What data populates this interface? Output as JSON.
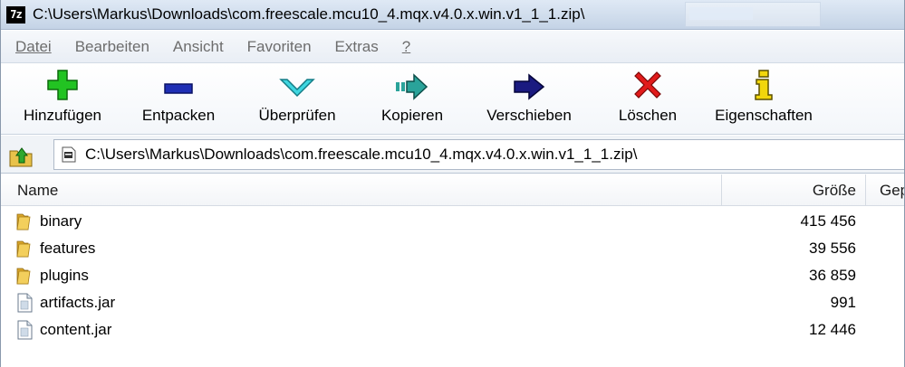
{
  "window": {
    "title": "C:\\Users\\Markus\\Downloads\\com.freescale.mcu10_4.mqx.v4.0.x.win.v1_1_1.zip\\",
    "app_icon_label": "7z"
  },
  "menu": {
    "items": [
      {
        "label": "Datei"
      },
      {
        "label": "Bearbeiten"
      },
      {
        "label": "Ansicht"
      },
      {
        "label": "Favoriten"
      },
      {
        "label": "Extras"
      },
      {
        "label": "?"
      }
    ]
  },
  "toolbar": {
    "buttons": [
      {
        "label": "Hinzufügen",
        "icon": "plus-icon",
        "color": "#22c322"
      },
      {
        "label": "Entpacken",
        "icon": "minus-icon",
        "color": "#1f2fb5"
      },
      {
        "label": "Überprüfen",
        "icon": "check-icon",
        "color": "#3fd6e0"
      },
      {
        "label": "Kopieren",
        "icon": "copy-arrow-icon",
        "color": "#2aa39a"
      },
      {
        "label": "Verschieben",
        "icon": "move-arrow-icon",
        "color": "#1a1a80"
      },
      {
        "label": "Löschen",
        "icon": "delete-x-icon",
        "color": "#e11b1b"
      },
      {
        "label": "Eigenschaften",
        "icon": "info-icon",
        "color": "#f2d60c"
      }
    ]
  },
  "address": {
    "path": "C:\\Users\\Markus\\Downloads\\com.freescale.mcu10_4.mqx.v4.0.x.win.v1_1_1.zip\\"
  },
  "list": {
    "columns": [
      {
        "label": "Name"
      },
      {
        "label": "Größe"
      },
      {
        "label": "Gep"
      }
    ],
    "rows": [
      {
        "name": "binary",
        "size": "415 456",
        "type": "folder"
      },
      {
        "name": "features",
        "size": "39 556",
        "type": "folder"
      },
      {
        "name": "plugins",
        "size": "36 859",
        "type": "folder"
      },
      {
        "name": "artifacts.jar",
        "size": "991",
        "type": "file"
      },
      {
        "name": "content.jar",
        "size": "12 446",
        "type": "file"
      }
    ]
  }
}
